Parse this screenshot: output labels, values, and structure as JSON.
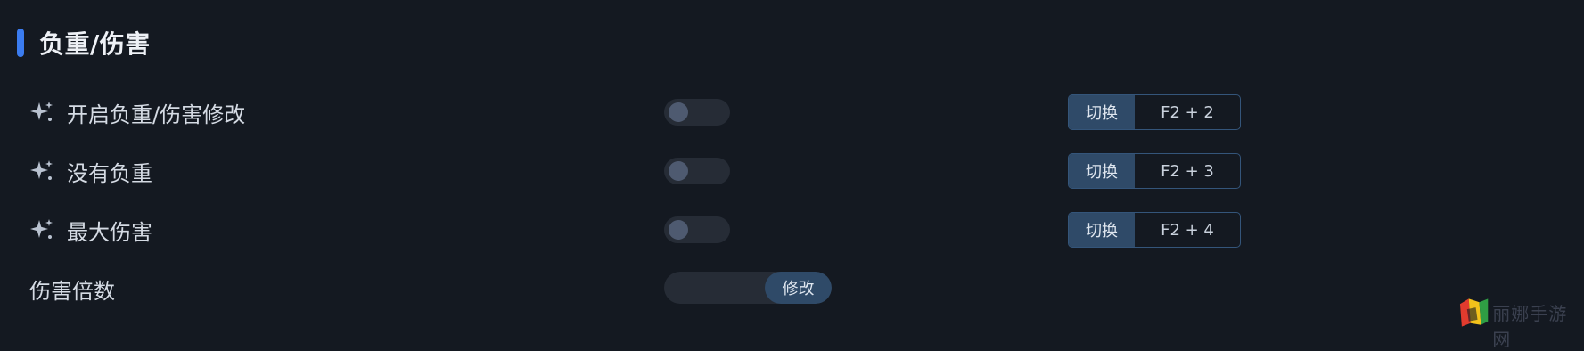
{
  "section": {
    "title": "负重/伤害",
    "accent_color": "#3b7cf0"
  },
  "options": [
    {
      "label": "开启负重/伤害修改",
      "icon": "sparkle-icon",
      "toggle_on": false,
      "hotkey_button": "切换",
      "hotkey": "F2 + 2"
    },
    {
      "label": "没有负重",
      "icon": "sparkle-icon",
      "toggle_on": false,
      "hotkey_button": "切换",
      "hotkey": "F2 + 3"
    },
    {
      "label": "最大伤害",
      "icon": "sparkle-icon",
      "toggle_on": false,
      "hotkey_button": "切换",
      "hotkey": "F2 + 4"
    }
  ],
  "damage_multiplier": {
    "label": "伤害倍数",
    "value": "",
    "button": "修改"
  },
  "watermark": {
    "text": "丽娜手游网"
  }
}
